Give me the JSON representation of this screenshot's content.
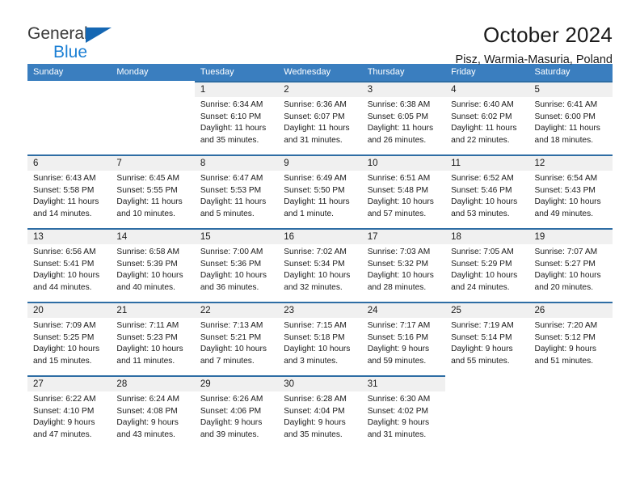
{
  "brand": {
    "name_line1": "General",
    "name_line2": "Blue",
    "accent_color": "#1b7fd4",
    "triangle_color": "#1567b3"
  },
  "header": {
    "title": "October 2024",
    "subtitle": "Pisz, Warmia-Masuria, Poland"
  },
  "theme": {
    "header_bar_color": "#3a7ebf",
    "day_band_color": "#f0f0f0",
    "row_divider_color": "#2e6da4",
    "text_color": "#1a1a1a"
  },
  "weekdays": [
    "Sunday",
    "Monday",
    "Tuesday",
    "Wednesday",
    "Thursday",
    "Friday",
    "Saturday"
  ],
  "labels": {
    "sunrise_prefix": "Sunrise: ",
    "sunset_prefix": "Sunset: ",
    "daylight_prefix": "Daylight: "
  },
  "weeks": [
    [
      {
        "day": "",
        "blank": true
      },
      {
        "day": "",
        "blank": true
      },
      {
        "day": "1",
        "sunrise": "Sunrise: 6:34 AM",
        "sunset": "Sunset: 6:10 PM",
        "daylight": "Daylight: 11 hours and 35 minutes."
      },
      {
        "day": "2",
        "sunrise": "Sunrise: 6:36 AM",
        "sunset": "Sunset: 6:07 PM",
        "daylight": "Daylight: 11 hours and 31 minutes."
      },
      {
        "day": "3",
        "sunrise": "Sunrise: 6:38 AM",
        "sunset": "Sunset: 6:05 PM",
        "daylight": "Daylight: 11 hours and 26 minutes."
      },
      {
        "day": "4",
        "sunrise": "Sunrise: 6:40 AM",
        "sunset": "Sunset: 6:02 PM",
        "daylight": "Daylight: 11 hours and 22 minutes."
      },
      {
        "day": "5",
        "sunrise": "Sunrise: 6:41 AM",
        "sunset": "Sunset: 6:00 PM",
        "daylight": "Daylight: 11 hours and 18 minutes."
      }
    ],
    [
      {
        "day": "6",
        "sunrise": "Sunrise: 6:43 AM",
        "sunset": "Sunset: 5:58 PM",
        "daylight": "Daylight: 11 hours and 14 minutes."
      },
      {
        "day": "7",
        "sunrise": "Sunrise: 6:45 AM",
        "sunset": "Sunset: 5:55 PM",
        "daylight": "Daylight: 11 hours and 10 minutes."
      },
      {
        "day": "8",
        "sunrise": "Sunrise: 6:47 AM",
        "sunset": "Sunset: 5:53 PM",
        "daylight": "Daylight: 11 hours and 5 minutes."
      },
      {
        "day": "9",
        "sunrise": "Sunrise: 6:49 AM",
        "sunset": "Sunset: 5:50 PM",
        "daylight": "Daylight: 11 hours and 1 minute."
      },
      {
        "day": "10",
        "sunrise": "Sunrise: 6:51 AM",
        "sunset": "Sunset: 5:48 PM",
        "daylight": "Daylight: 10 hours and 57 minutes."
      },
      {
        "day": "11",
        "sunrise": "Sunrise: 6:52 AM",
        "sunset": "Sunset: 5:46 PM",
        "daylight": "Daylight: 10 hours and 53 minutes."
      },
      {
        "day": "12",
        "sunrise": "Sunrise: 6:54 AM",
        "sunset": "Sunset: 5:43 PM",
        "daylight": "Daylight: 10 hours and 49 minutes."
      }
    ],
    [
      {
        "day": "13",
        "sunrise": "Sunrise: 6:56 AM",
        "sunset": "Sunset: 5:41 PM",
        "daylight": "Daylight: 10 hours and 44 minutes."
      },
      {
        "day": "14",
        "sunrise": "Sunrise: 6:58 AM",
        "sunset": "Sunset: 5:39 PM",
        "daylight": "Daylight: 10 hours and 40 minutes."
      },
      {
        "day": "15",
        "sunrise": "Sunrise: 7:00 AM",
        "sunset": "Sunset: 5:36 PM",
        "daylight": "Daylight: 10 hours and 36 minutes."
      },
      {
        "day": "16",
        "sunrise": "Sunrise: 7:02 AM",
        "sunset": "Sunset: 5:34 PM",
        "daylight": "Daylight: 10 hours and 32 minutes."
      },
      {
        "day": "17",
        "sunrise": "Sunrise: 7:03 AM",
        "sunset": "Sunset: 5:32 PM",
        "daylight": "Daylight: 10 hours and 28 minutes."
      },
      {
        "day": "18",
        "sunrise": "Sunrise: 7:05 AM",
        "sunset": "Sunset: 5:29 PM",
        "daylight": "Daylight: 10 hours and 24 minutes."
      },
      {
        "day": "19",
        "sunrise": "Sunrise: 7:07 AM",
        "sunset": "Sunset: 5:27 PM",
        "daylight": "Daylight: 10 hours and 20 minutes."
      }
    ],
    [
      {
        "day": "20",
        "sunrise": "Sunrise: 7:09 AM",
        "sunset": "Sunset: 5:25 PM",
        "daylight": "Daylight: 10 hours and 15 minutes."
      },
      {
        "day": "21",
        "sunrise": "Sunrise: 7:11 AM",
        "sunset": "Sunset: 5:23 PM",
        "daylight": "Daylight: 10 hours and 11 minutes."
      },
      {
        "day": "22",
        "sunrise": "Sunrise: 7:13 AM",
        "sunset": "Sunset: 5:21 PM",
        "daylight": "Daylight: 10 hours and 7 minutes."
      },
      {
        "day": "23",
        "sunrise": "Sunrise: 7:15 AM",
        "sunset": "Sunset: 5:18 PM",
        "daylight": "Daylight: 10 hours and 3 minutes."
      },
      {
        "day": "24",
        "sunrise": "Sunrise: 7:17 AM",
        "sunset": "Sunset: 5:16 PM",
        "daylight": "Daylight: 9 hours and 59 minutes."
      },
      {
        "day": "25",
        "sunrise": "Sunrise: 7:19 AM",
        "sunset": "Sunset: 5:14 PM",
        "daylight": "Daylight: 9 hours and 55 minutes."
      },
      {
        "day": "26",
        "sunrise": "Sunrise: 7:20 AM",
        "sunset": "Sunset: 5:12 PM",
        "daylight": "Daylight: 9 hours and 51 minutes."
      }
    ],
    [
      {
        "day": "27",
        "sunrise": "Sunrise: 6:22 AM",
        "sunset": "Sunset: 4:10 PM",
        "daylight": "Daylight: 9 hours and 47 minutes."
      },
      {
        "day": "28",
        "sunrise": "Sunrise: 6:24 AM",
        "sunset": "Sunset: 4:08 PM",
        "daylight": "Daylight: 9 hours and 43 minutes."
      },
      {
        "day": "29",
        "sunrise": "Sunrise: 6:26 AM",
        "sunset": "Sunset: 4:06 PM",
        "daylight": "Daylight: 9 hours and 39 minutes."
      },
      {
        "day": "30",
        "sunrise": "Sunrise: 6:28 AM",
        "sunset": "Sunset: 4:04 PM",
        "daylight": "Daylight: 9 hours and 35 minutes."
      },
      {
        "day": "31",
        "sunrise": "Sunrise: 6:30 AM",
        "sunset": "Sunset: 4:02 PM",
        "daylight": "Daylight: 9 hours and 31 minutes."
      },
      {
        "day": "",
        "blank": true
      },
      {
        "day": "",
        "blank": true
      }
    ]
  ]
}
